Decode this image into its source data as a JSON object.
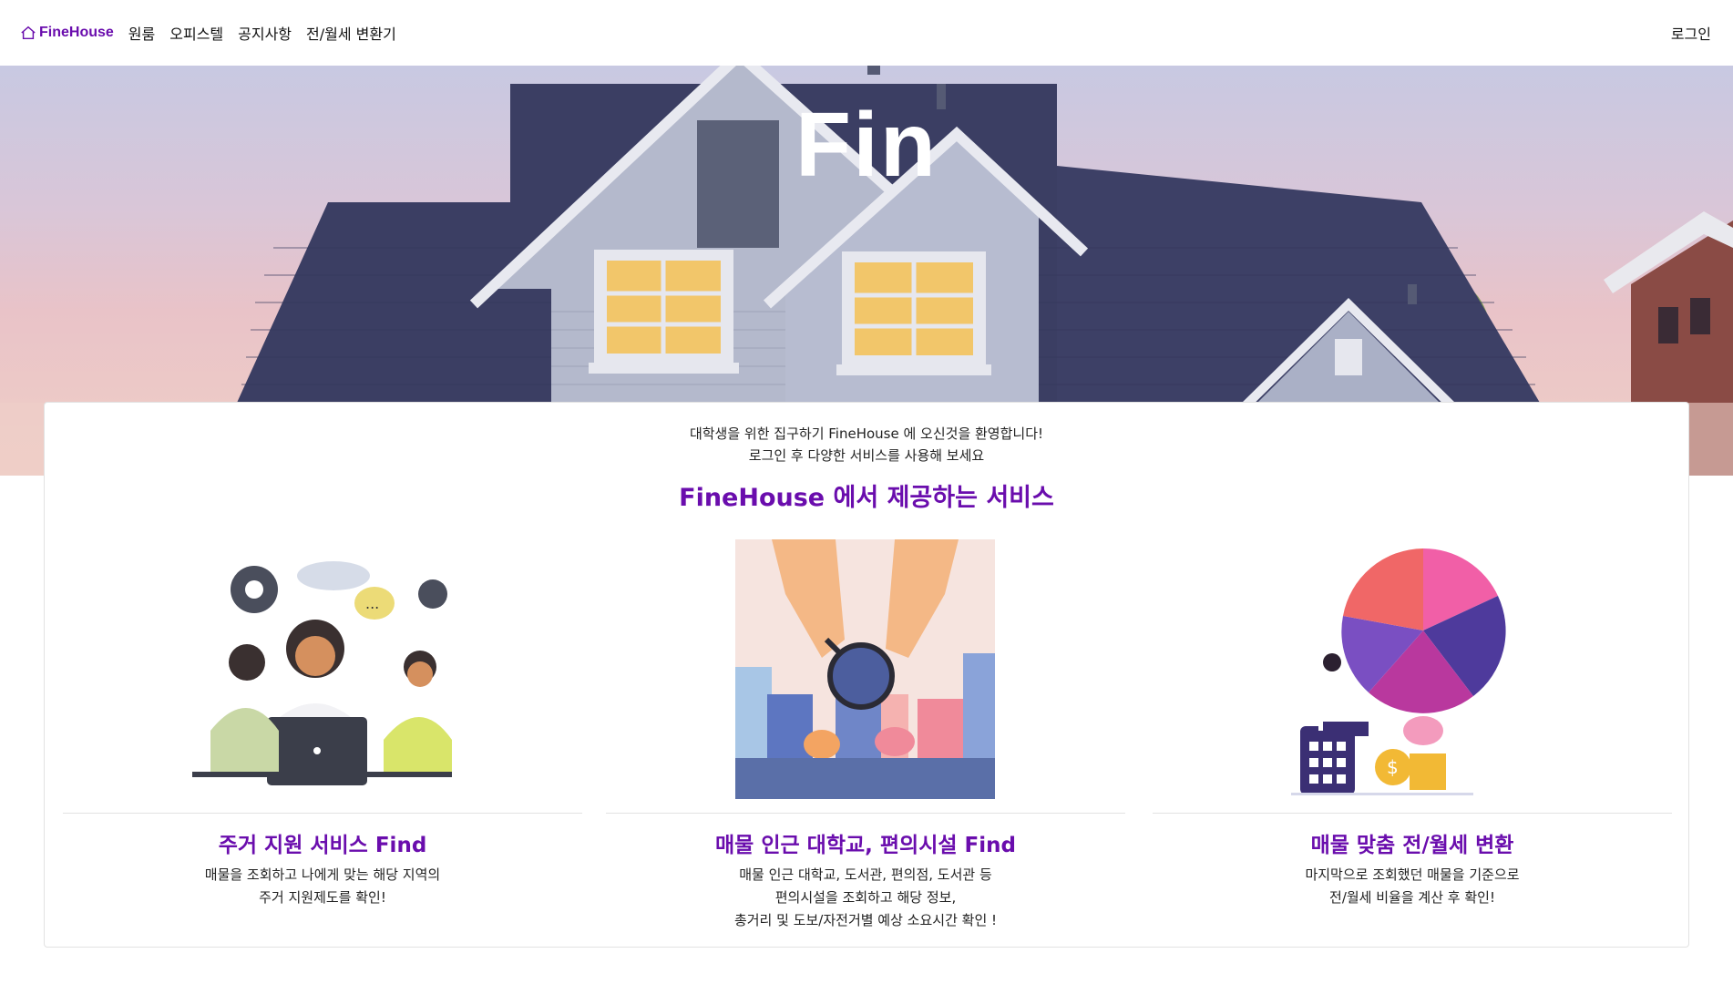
{
  "nav": {
    "brand": "FineHouse",
    "links": [
      "원룸",
      "오피스텔",
      "공지사항",
      "전/월세 변환기"
    ],
    "login": "로그인"
  },
  "hero": {
    "title": "Fin"
  },
  "welcome": {
    "line1": "대학생을 위한 집구하기 FineHouse 에 오신것을 환영합니다!",
    "line2": "로그인 후 다양한 서비스를 사용해 보세요"
  },
  "services": {
    "title": "FineHouse 에서 제공하는 서비스",
    "items": [
      {
        "title": "주거 지원 서비스 Find",
        "desc": [
          "매물을 조회하고 나에게 맞는 해당 지역의",
          "주거 지원제도를 확인!"
        ]
      },
      {
        "title": "매물 인근 대학교, 편의시설 Find",
        "desc": [
          "매물 인근 대학교, 도서관, 편의점, 도서관 등",
          "편의시설을 조회하고 해당 정보,",
          "총거리 및 도보/자전거별 예상 소요시간 확인 !"
        ]
      },
      {
        "title": "매물 맞춤 전/월세 변환",
        "desc": [
          "마지막으로 조회했던 매물을 기준으로",
          "전/월세 비율을 계산 후 확인!"
        ]
      }
    ]
  },
  "colors": {
    "brand": "#6a0dad",
    "roof": "#3b3e63",
    "siding": "#aeb3c8"
  }
}
